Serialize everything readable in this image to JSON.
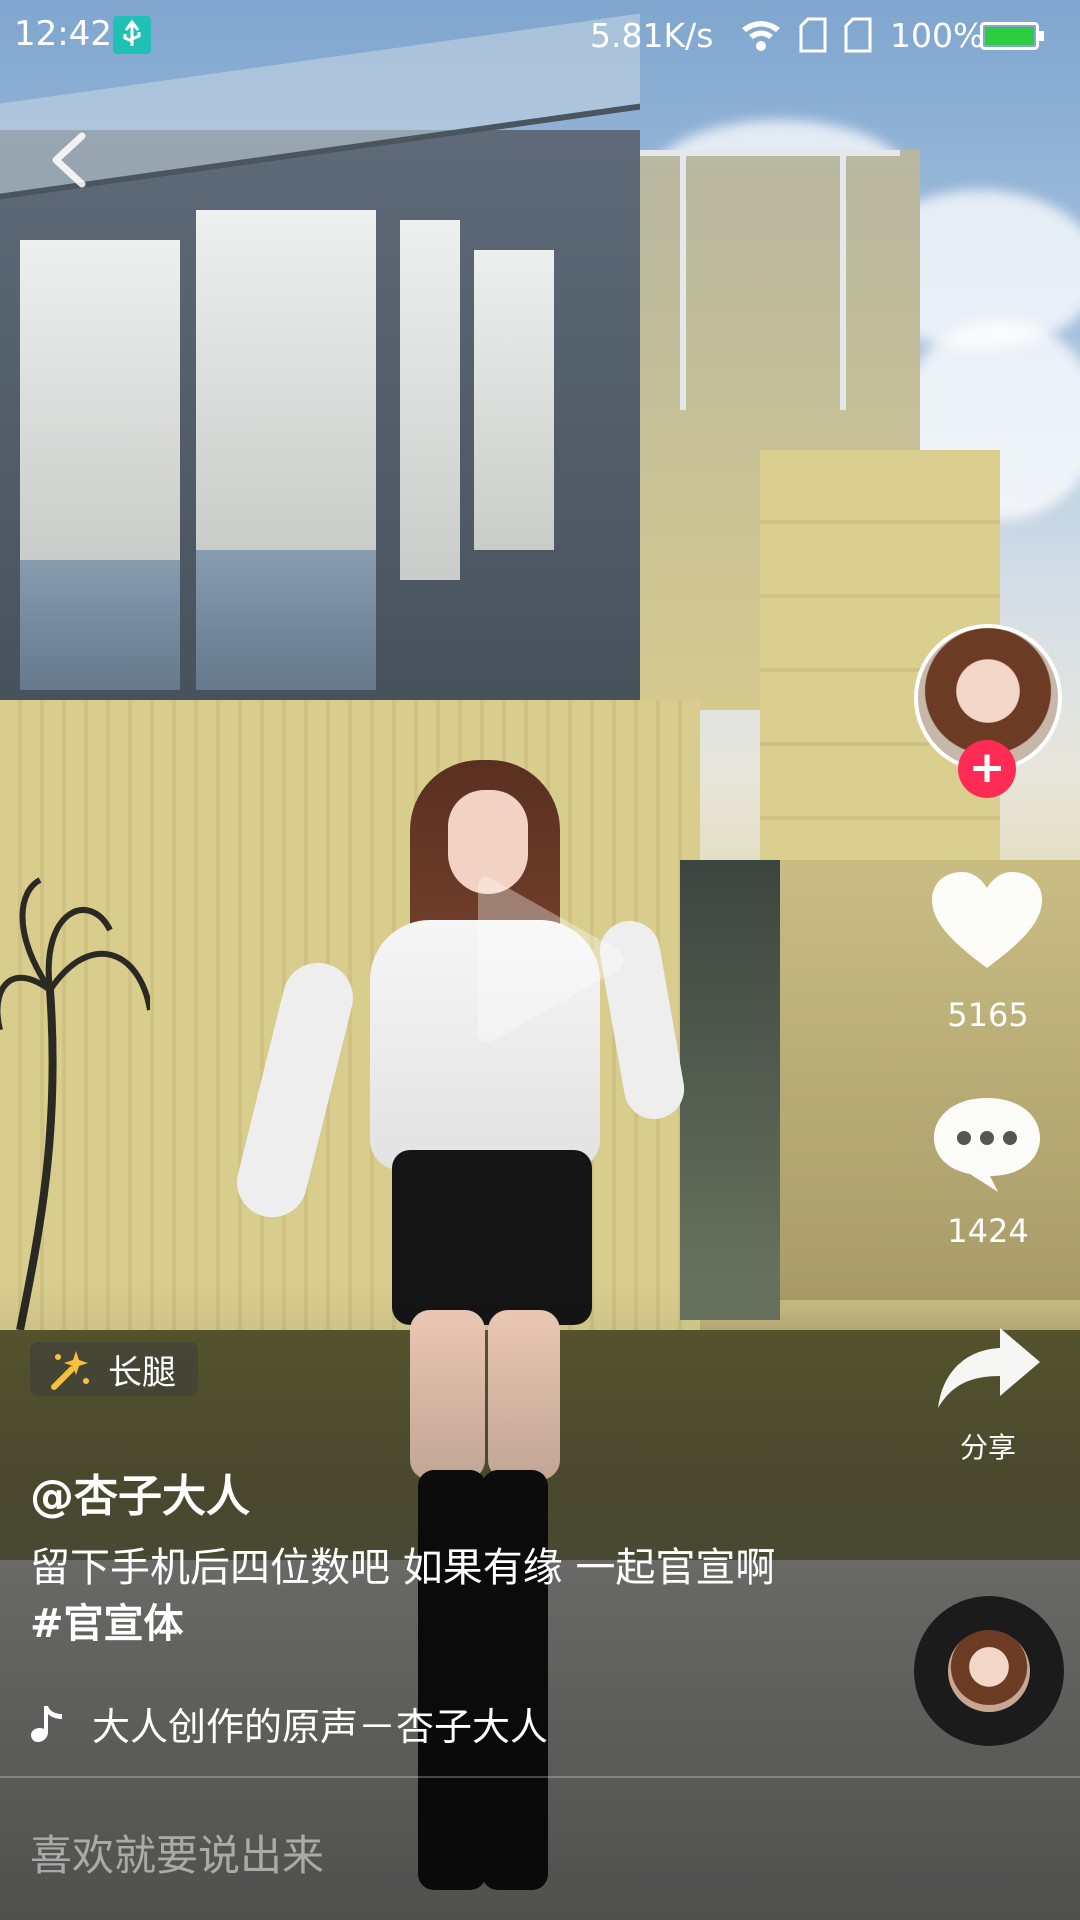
{
  "status_bar": {
    "time": "12:42",
    "speed": "5.81K/s",
    "battery": "100%",
    "icons": [
      "usb-icon",
      "wifi-icon",
      "sim-icon",
      "sim-icon",
      "battery-icon"
    ]
  },
  "nav": {
    "back_icon": "chevron-left-icon"
  },
  "player": {
    "play_icon": "play-icon"
  },
  "actions": {
    "likes": "5165",
    "comments": "1424",
    "share_label": "分享",
    "follow_symbol": "+"
  },
  "post": {
    "tag": "长腿",
    "author": "@杏子大人",
    "caption_text": "留下手机后四位数吧 如果有缘 一起官宣啊",
    "hashtag": "#官宣体",
    "music": "大人创作的原声－杏子大人"
  },
  "comment_bar": {
    "placeholder": "喜欢就要说出来"
  },
  "colors": {
    "accent": "#fe2c55",
    "usb": "#1fc0b5",
    "battery": "#2ecc40"
  }
}
